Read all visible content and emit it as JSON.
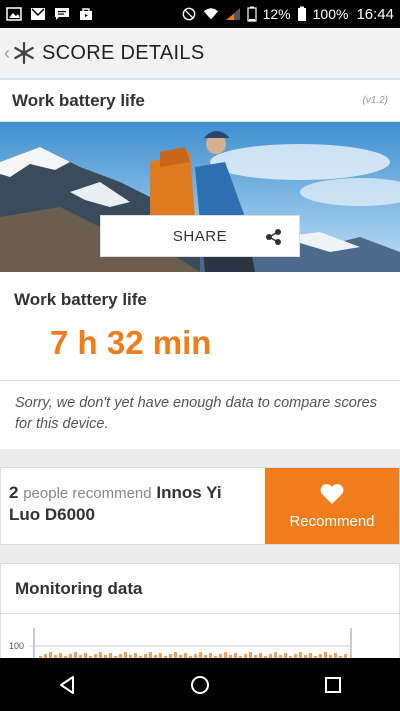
{
  "status_bar": {
    "battery_small": "12%",
    "battery": "100%",
    "time": "16:44"
  },
  "app_bar": {
    "title": "SCORE DETAILS"
  },
  "hero": {
    "title": "Work battery life",
    "version": "(v1.2)",
    "share_label": "SHARE"
  },
  "result": {
    "label": "Work battery life",
    "value": "7 h 32 min",
    "note": "Sorry, we don't yet have enough data to compare scores for this device."
  },
  "recommend": {
    "count": "2",
    "text": "people recommend",
    "device": "Innos Yi Luo D6000",
    "button_label": "Recommend"
  },
  "monitoring": {
    "title": "Monitoring data",
    "y_tick": "100"
  },
  "colors": {
    "accent": "#f07c1b"
  }
}
